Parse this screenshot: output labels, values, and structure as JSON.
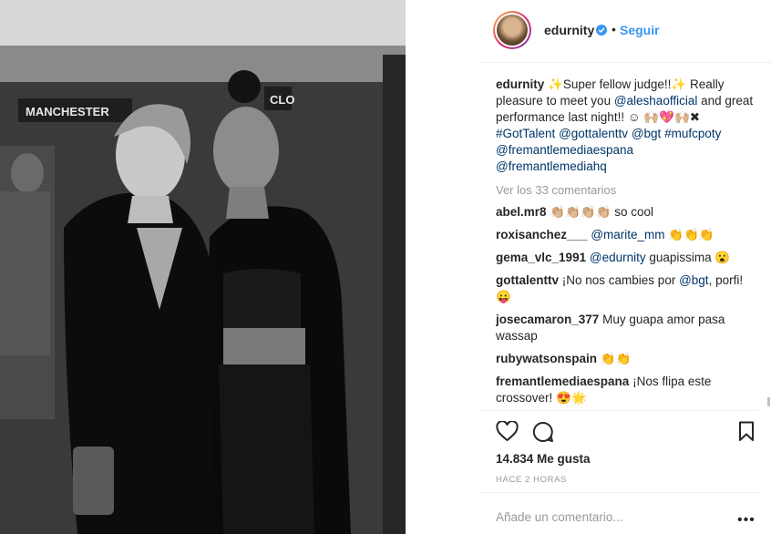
{
  "post": {
    "photo_label": "MANCHESTER",
    "photo_label_right": "CLO",
    "author": "edurnity",
    "follow_label": "Seguir",
    "dot": "•",
    "caption_user": "edurnity",
    "caption_parts": [
      "Super fellow judge!!",
      "Really pleasure to meet you ",
      "@aleshaofficial",
      " and great performance last night!! ☺ 🙌🏼💖🙌🏼✖"
    ],
    "caption_tags": [
      "#GotTalent",
      "@gottalenttv",
      "@bgt",
      "#mufcpoty",
      "@fremantlemediaespana",
      "@fremantlemediahq"
    ],
    "view_all": "Ver los 33 comentarios",
    "comments": [
      {
        "user": "abel.mr8",
        "text": "👏🏼👏🏼👏🏼👏🏼 so cool"
      },
      {
        "user": "roxisanchez___",
        "mention": "@marite_mm",
        "text": " 👏👏👏"
      },
      {
        "user": "gema_vlc_1991",
        "mention": "@edurnity",
        "text": " guapissima 😮"
      },
      {
        "user": "gottalenttv",
        "text": "¡No nos cambies por ",
        "mention": "@bgt",
        "after": ", porfi! 😛"
      },
      {
        "user": "josecamaron_377",
        "text": "Muy guapa amor pasa wassap"
      },
      {
        "user": "rubywatsonspain",
        "text": "👏👏"
      },
      {
        "user": "fremantlemediaespana",
        "text": "¡Nos flipa este crossover! 😍🌟"
      }
    ],
    "likes": "14.834 Me gusta",
    "time": "HACE 2 HORAS",
    "add_comment_placeholder": "Añade un comentario...",
    "more": "•••"
  }
}
